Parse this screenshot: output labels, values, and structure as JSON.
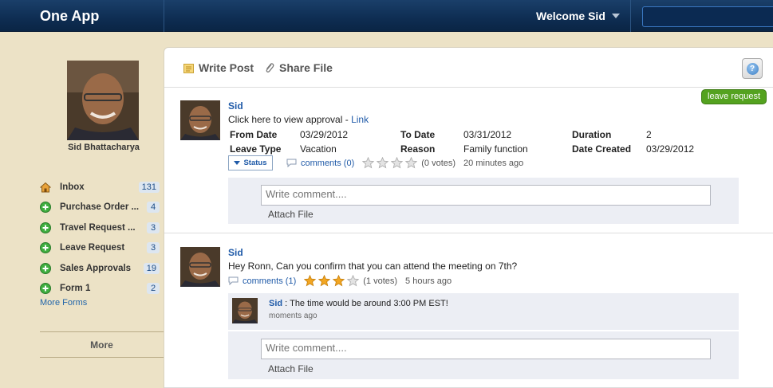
{
  "app": {
    "title": "One App",
    "welcome": "Welcome Sid"
  },
  "profile": {
    "name": "Sid Bhattacharya"
  },
  "nav": [
    {
      "label": "Inbox",
      "count": "131",
      "icon": "home-icon"
    },
    {
      "label": "Purchase Order ...",
      "count": "4",
      "icon": "plus-circle-icon"
    },
    {
      "label": "Travel Request ...",
      "count": "3",
      "icon": "plus-circle-icon"
    },
    {
      "label": "Leave Request",
      "count": "3",
      "icon": "plus-circle-icon"
    },
    {
      "label": "Sales Approvals",
      "count": "19",
      "icon": "plus-circle-icon"
    },
    {
      "label": "Form 1",
      "count": "2",
      "icon": "plus-circle-icon"
    }
  ],
  "sidebar": {
    "more_forms": "More Forms",
    "more": "More"
  },
  "toolbar": {
    "write_post": "Write Post",
    "share_file": "Share File"
  },
  "post1": {
    "badge": "leave request",
    "author": "Sid",
    "text": "Click here to view approval - ",
    "link": "Link",
    "fields": {
      "from_date_label": "From Date",
      "from_date": "03/29/2012",
      "to_date_label": "To Date",
      "to_date": "03/31/2012",
      "duration_label": "Duration",
      "duration": "2",
      "leave_type_label": "Leave Type",
      "leave_type": "Vacation",
      "reason_label": "Reason",
      "reason": "Family function",
      "date_created_label": "Date Created",
      "date_created": "03/29/2012"
    },
    "status": "Status",
    "comments": "comments (0)",
    "rating": 0,
    "votes": "(0 votes)",
    "time": "20 minutes ago",
    "comment_placeholder": "Write comment....",
    "attach": "Attach File"
  },
  "post2": {
    "author": "Sid",
    "text": "Hey Ronn, Can you confirm that you can attend the meeting on 7th?",
    "comments": "comments (1)",
    "rating": 3,
    "votes": "(1 votes)",
    "time": "5 hours ago",
    "reply": {
      "author": "Sid",
      "text": " : The time would be around 3:00 PM EST!",
      "time": "moments ago"
    },
    "comment_placeholder": "Write comment....",
    "attach": "Attach File"
  },
  "colors": {
    "topbar": "#0e2d52",
    "accent_link": "#1f5aa8",
    "badge_green": "#54a21f",
    "sidebar_bg": "#ece2c6",
    "star_gold": "#f2a623"
  }
}
